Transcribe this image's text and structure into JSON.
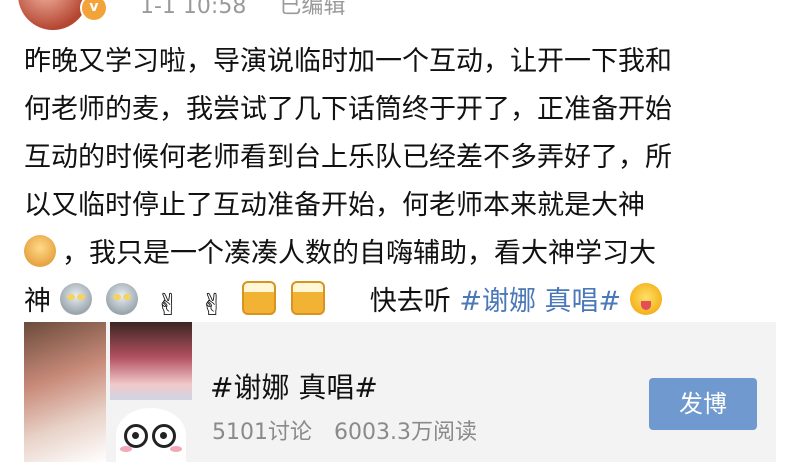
{
  "header": {
    "time": "1-1 10:58",
    "edited_label": "已编辑"
  },
  "post": {
    "lines": [
      "昨晚又学习啦，导演说临时加一个互动，让开一下我和",
      "何老师的麦，我尝试了几下话筒终于开了，正准备开始",
      "互动的时候何老师看到台上乐队已经差不多弄好了，所",
      "以又临时停止了互动准备开始，何老师本来就是大神"
    ],
    "line5_text": "，我只是一个凑凑人数的自嗨辅助，看大神学习大",
    "line6_start": "神",
    "line6_text": "快去听",
    "topic": "#谢娜 真唱#",
    "emoticons": [
      "baby-icon",
      "ultraman-icon",
      "ultraman-icon",
      "victory-hand-icon",
      "victory-hand-icon",
      "beer-icon",
      "beer-icon",
      "tongue-face-icon"
    ]
  },
  "card": {
    "title": "#谢娜 真唱#",
    "discussions": "5101讨论",
    "reads": "6003.3万阅读",
    "button_label": "发博"
  },
  "colors": {
    "topic_link": "#4b78b8",
    "button_bg": "#6f99cf",
    "card_bg": "#f3f3f3",
    "meta_text": "#9a9a9a"
  }
}
